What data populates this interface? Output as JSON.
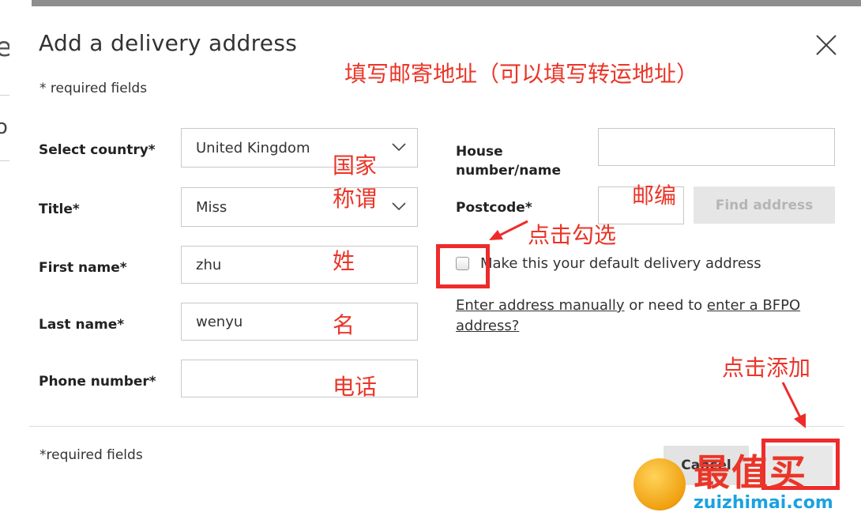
{
  "background": {
    "fragment_top": "e",
    "fragment_bottom": "o"
  },
  "modal": {
    "title": "Add a delivery address",
    "required_note_top": "* required fields",
    "required_note_bottom": "*required fields"
  },
  "form": {
    "country": {
      "label": "Select country*",
      "value": "United Kingdom"
    },
    "title": {
      "label": "Title*",
      "value": "Miss"
    },
    "first_name": {
      "label": "First name*",
      "value": "zhu"
    },
    "last_name": {
      "label": "Last name*",
      "value": "wenyu"
    },
    "phone": {
      "label": "Phone number*",
      "value": ""
    },
    "house": {
      "label": "House number/name",
      "value": ""
    },
    "postcode": {
      "label": "Postcode*",
      "value": ""
    },
    "find_address": "Find address",
    "default_checkbox_label": "Make this your default delivery address",
    "links": {
      "manual": "Enter address manually",
      "middle": " or need to ",
      "bfpo": "enter a BFPO address?"
    }
  },
  "footer": {
    "cancel_label": "Cancel"
  },
  "annotations": {
    "header": "填写邮寄地址（可以填写转运地址）",
    "country": "国家",
    "title": "称谓",
    "surname": "姓",
    "given": "名",
    "phone": "电话",
    "postcode": "邮编",
    "checkbox": "点击勾选",
    "add": "点击添加"
  },
  "watermark": {
    "big": "最值买",
    "url": "zuizhimai.com"
  },
  "colors": {
    "annotation_red": "#ea3528",
    "button_grey": "#e6e6e6"
  }
}
